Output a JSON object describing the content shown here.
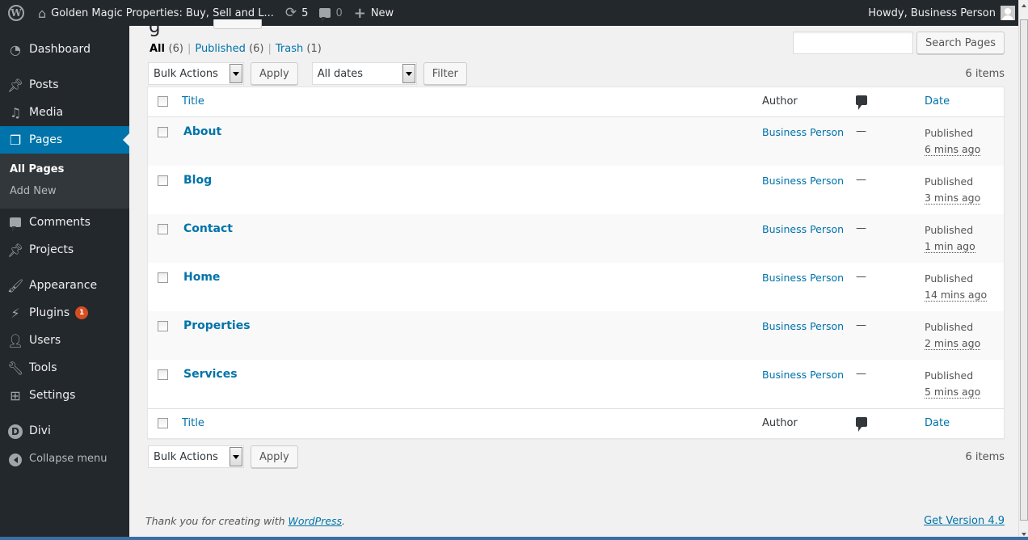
{
  "adminbar": {
    "site_name": "Golden Magic Properties: Buy, Sell and L...",
    "updates_count": "5",
    "comments_count": "0",
    "new_label": "New",
    "greeting": "Howdy, Business Person"
  },
  "sidebar": {
    "items": [
      {
        "label": "Dashboard",
        "icon": "dashboard-icon"
      },
      {
        "label": "Posts",
        "icon": "pin-icon"
      },
      {
        "label": "Media",
        "icon": "media-icon"
      },
      {
        "label": "Pages",
        "icon": "pages-icon"
      },
      {
        "label": "Comments",
        "icon": "comment-icon"
      },
      {
        "label": "Projects",
        "icon": "pin-icon"
      },
      {
        "label": "Appearance",
        "icon": "brush-icon"
      },
      {
        "label": "Plugins",
        "icon": "plug-icon",
        "badge": "1"
      },
      {
        "label": "Users",
        "icon": "user-icon"
      },
      {
        "label": "Tools",
        "icon": "wrench-icon"
      },
      {
        "label": "Settings",
        "icon": "sliders-icon"
      },
      {
        "label": "Divi",
        "icon": "divi-icon"
      }
    ],
    "submenu": {
      "all_pages": "All Pages",
      "add_new": "Add New"
    },
    "collapse_label": "Collapse menu"
  },
  "main": {
    "title_fragment": "g",
    "views": {
      "all": "All",
      "all_count": "(6)",
      "published": "Published",
      "published_count": "(6)",
      "trash": "Trash",
      "trash_count": "(1)"
    },
    "search_placeholder": "",
    "search_button": "Search Pages",
    "bulk_actions": "Bulk Actions",
    "apply": "Apply",
    "dates_filter": "All dates",
    "filter": "Filter",
    "items_count": "6 items",
    "columns": {
      "title": "Title",
      "author": "Author",
      "date": "Date"
    },
    "rows": [
      {
        "title": "About",
        "author": "Business Person",
        "comments": "—",
        "status": "Published",
        "ago": "6 mins ago"
      },
      {
        "title": "Blog",
        "author": "Business Person",
        "comments": "—",
        "status": "Published",
        "ago": "3 mins ago"
      },
      {
        "title": "Contact",
        "author": "Business Person",
        "comments": "—",
        "status": "Published",
        "ago": "1 min ago"
      },
      {
        "title": "Home",
        "author": "Business Person",
        "comments": "—",
        "status": "Published",
        "ago": "14 mins ago"
      },
      {
        "title": "Properties",
        "author": "Business Person",
        "comments": "—",
        "status": "Published",
        "ago": "2 mins ago"
      },
      {
        "title": "Services",
        "author": "Business Person",
        "comments": "—",
        "status": "Published",
        "ago": "5 mins ago"
      }
    ]
  },
  "footer": {
    "thanks_prefix": "Thank you for creating with ",
    "wordpress_link": "WordPress",
    "thanks_suffix": ".",
    "version_link": "Get Version 4.9"
  },
  "colors": {
    "accent": "#0073aa",
    "adminbar": "#23282d",
    "badge": "#d54e21"
  }
}
